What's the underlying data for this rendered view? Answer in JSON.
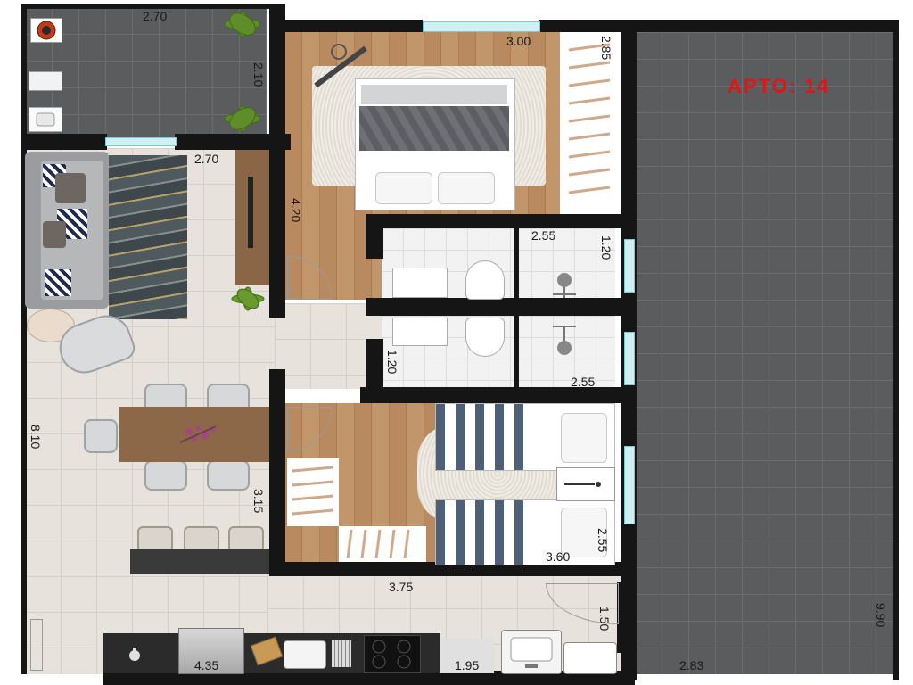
{
  "unit_label": "APTO: 14",
  "colors": {
    "unit_label": "#e21414",
    "walls": "#151515",
    "floor_tile": "#e7e3dc",
    "garage_floor": "#5b5c5e",
    "wood_floor": "#b98a5f",
    "window_glass": "#cfeff2"
  },
  "dimensions": {
    "terrace_width": "2.70",
    "terrace_depth": "2.10",
    "living_width": "2.70",
    "master_width": "3.00",
    "master_closet": "2.85",
    "master_depth": "4.20",
    "bath1_width": "2.55",
    "bath1_depth": "1.20",
    "bath2_depth": "1.20",
    "bath2_width": "2.55",
    "total_depth": "8.10",
    "bedroom2_depth_left": "3.15",
    "bedroom2_width": "3.60",
    "bedroom2_depth_right": "2.55",
    "hall_width": "3.75",
    "kitchen_width": "4.35",
    "laundry_width": "1.95",
    "laundry_depth": "1.50",
    "garage_width": "2.83",
    "garage_depth": "9.90"
  },
  "icons": [
    "grill-icon",
    "planter-icon",
    "sink-icon",
    "sofa-icon",
    "rug-icon",
    "dining-table-icon",
    "bed-icon",
    "toilet-icon",
    "shower-icon",
    "stove-icon",
    "fridge-icon",
    "washing-machine-icon",
    "tank-icon"
  ]
}
